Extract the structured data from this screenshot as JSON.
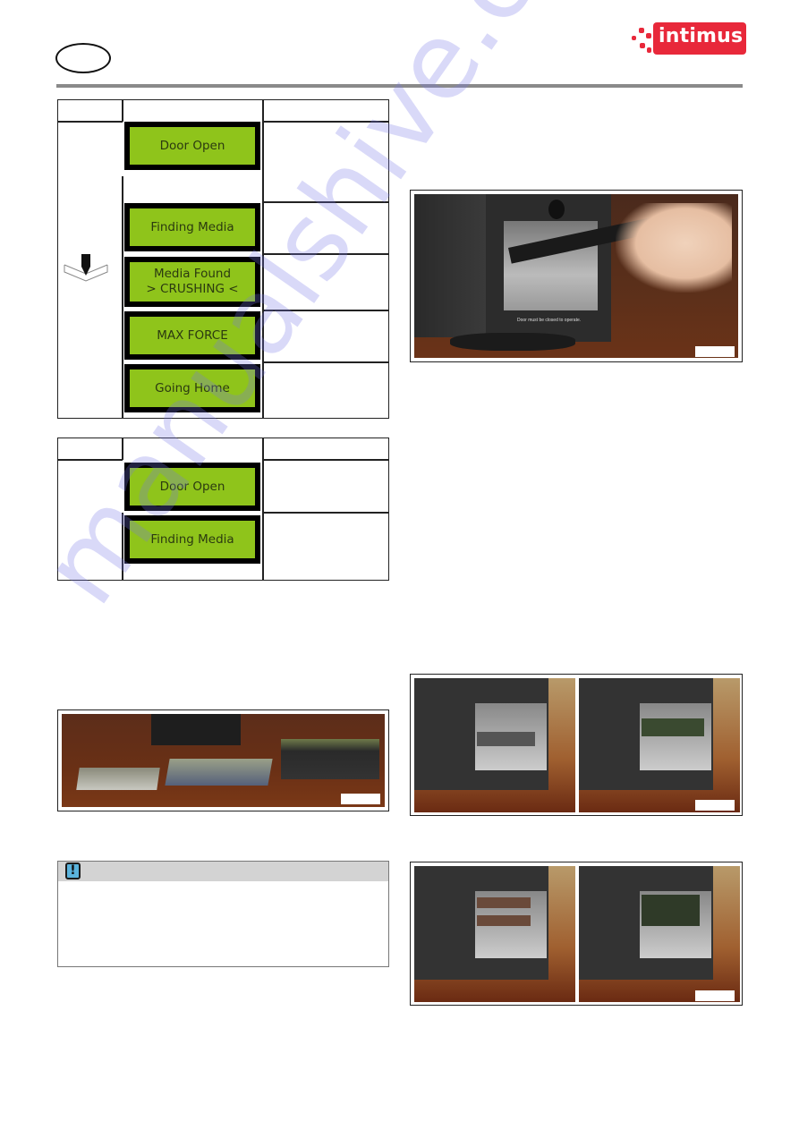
{
  "header": {
    "logo_text": "intimus",
    "brand_color": "#e8283a",
    "language_badge": ""
  },
  "table1": {
    "rows": [
      {
        "display": [
          "Door Open"
        ]
      },
      {
        "display": [
          "Finding Media"
        ]
      },
      {
        "display": [
          "Media Found",
          "> CRUSHING <"
        ]
      },
      {
        "display": [
          "MAX FORCE"
        ]
      },
      {
        "display": [
          "Going Home"
        ]
      }
    ],
    "step_icon": "press-down-icon"
  },
  "table2": {
    "rows": [
      {
        "display": [
          "Door Open"
        ]
      },
      {
        "display": [
          "Finding Media"
        ]
      }
    ]
  },
  "lcd_colors": {
    "screen": "#8fc41b",
    "text": "#2b3a10",
    "frame": "#000000"
  },
  "figures": {
    "inserting_media": {
      "caption": "Door must be closed to operate.",
      "alt": "Hand inserting a hard drive into the crusher chamber"
    },
    "media_types": {
      "alt": "Various hard drives of different sizes on a wooden table"
    },
    "positions_a": {
      "alt": "Media positioned inside the chamber, two views"
    },
    "positions_b": {
      "alt": "Stacked media positioned inside the chamber, two views"
    }
  },
  "warning": {
    "icon": "exclamation-icon",
    "glyph": "!"
  },
  "watermark": "manualshive.com"
}
